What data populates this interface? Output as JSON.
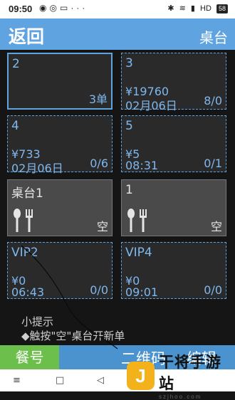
{
  "status_bar": {
    "time": "09:50",
    "left_icons": [
      "chat-icon",
      "wechat-icon",
      "folder-icon",
      "more-icon"
    ],
    "right_items": [
      "bluetooth-icon",
      "wifi-icon",
      "signal-icon",
      "HD"
    ],
    "battery": "58"
  },
  "header": {
    "back_label": "返回",
    "title": "桌台"
  },
  "tables": [
    {
      "name": "2",
      "line1": "",
      "line2": "",
      "bottom_right": "3单",
      "state": "selected"
    },
    {
      "name": "3",
      "line1": "¥19760",
      "line2": "02月06日",
      "bottom_right": "8/0",
      "state": "occupied"
    },
    {
      "name": "4",
      "line1": "¥733",
      "line2": "02月06日",
      "bottom_right": "0/6",
      "state": "occupied"
    },
    {
      "name": "5",
      "line1": "¥5",
      "line2": "08:31",
      "bottom_right": "0/1",
      "state": "occupied"
    },
    {
      "name": "桌台1",
      "line1": "",
      "line2": "",
      "bottom_right": "空",
      "state": "idle"
    },
    {
      "name": "1",
      "line1": "",
      "line2": "",
      "bottom_right": "空",
      "state": "idle"
    },
    {
      "name": "VIP2",
      "line1": "¥0",
      "line2": "06:43",
      "bottom_right": "0/0",
      "state": "occupied"
    },
    {
      "name": "VIP4",
      "line1": "¥0",
      "line2": "09:01",
      "bottom_right": "0/0",
      "state": "occupied"
    }
  ],
  "tip": {
    "title": "小提示",
    "text": "◆触按\"空\"桌台开新单"
  },
  "bottom_bar": {
    "order_no_label": "餐号",
    "qr_label": "二维码",
    "edit_label": "编辑"
  },
  "nav": {
    "menu": "≡",
    "home": "□",
    "back": "◁"
  },
  "watermark": {
    "logo": "J",
    "title": "干将手游站",
    "url": "szjhoo.com"
  },
  "colors": {
    "accent": "#5fa3e0",
    "green": "#6cbf4b",
    "card_bg": "#2a2a2a",
    "idle_bg": "#4a4a4a"
  }
}
